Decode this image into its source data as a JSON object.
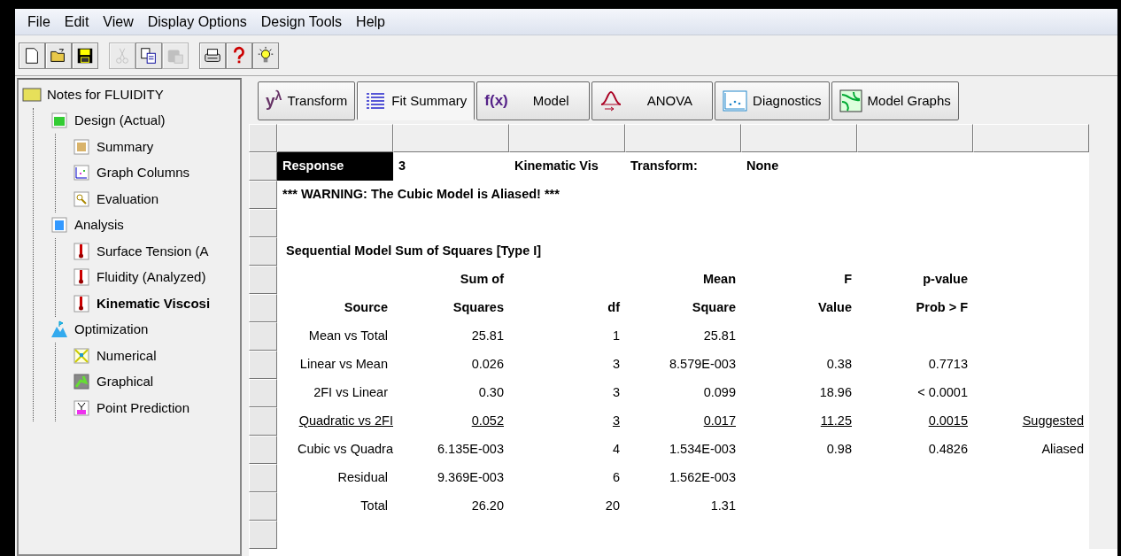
{
  "menu": [
    "File",
    "Edit",
    "View",
    "Display Options",
    "Design Tools",
    "Help"
  ],
  "toolbar": [
    {
      "kind": "new",
      "disabled": false
    },
    {
      "kind": "open",
      "disabled": false
    },
    {
      "kind": "save",
      "disabled": false
    },
    {
      "kind": "cut",
      "disabled": true
    },
    {
      "kind": "copy",
      "disabled": false
    },
    {
      "kind": "paste",
      "disabled": true
    },
    {
      "kind": "print",
      "disabled": false
    },
    {
      "kind": "help",
      "disabled": false
    },
    {
      "kind": "tip",
      "disabled": false
    }
  ],
  "tree": {
    "label": "Notes for FLUIDITY",
    "children": [
      {
        "label": "Design (Actual)",
        "kind": "design",
        "selected": false,
        "children": [
          {
            "label": "Summary",
            "kind": "summary",
            "selected": false
          },
          {
            "label": "Graph Columns",
            "kind": "graph",
            "selected": false
          },
          {
            "label": "Evaluation",
            "kind": "evaluation",
            "selected": false
          }
        ]
      },
      {
        "label": "Analysis",
        "kind": "analysis",
        "selected": false,
        "children": [
          {
            "label": "Surface Tension (A",
            "kind": "response",
            "selected": false
          },
          {
            "label": "Fluidity (Analyzed)",
            "kind": "response",
            "selected": false
          },
          {
            "label": "Kinematic Viscosi",
            "kind": "response",
            "selected": true
          }
        ]
      },
      {
        "label": "Optimization",
        "kind": "optimization",
        "selected": false,
        "children": [
          {
            "label": "Numerical",
            "kind": "numerical",
            "selected": false
          },
          {
            "label": "Graphical",
            "kind": "graphical",
            "selected": false
          },
          {
            "label": "Point Prediction",
            "kind": "point",
            "selected": false
          }
        ]
      }
    ]
  },
  "tabs": [
    {
      "kind": "transform",
      "icon_text": "y",
      "icon_sup": "λ",
      "label": "Transform",
      "selected": false
    },
    {
      "kind": "fit",
      "label": "Fit Summary",
      "selected": true
    },
    {
      "kind": "model",
      "icon_text": "f(x)",
      "label": "Model",
      "selected": false
    },
    {
      "kind": "anova",
      "label": "ANOVA",
      "selected": false
    },
    {
      "kind": "diagnostics",
      "label": "Diagnostics",
      "selected": false
    },
    {
      "kind": "graphs",
      "label": "Model Graphs",
      "selected": false
    }
  ],
  "response": {
    "label": "Response",
    "selected": true,
    "number": "3",
    "name": "Kinematic Vis",
    "transform_label": "Transform:",
    "transform": "None"
  },
  "warning": "*** WARNING:  The Cubic Model is Aliased! ***",
  "table_title": "Sequential Model Sum of Squares [Type I]",
  "header_rows": [
    [
      null,
      "Sum of",
      null,
      "Mean",
      "F",
      "p-value",
      null
    ],
    [
      "Source",
      "Squares",
      "df",
      "Square",
      "Value",
      "Prob > F",
      null
    ]
  ],
  "rows": [
    {
      "cells": [
        "Mean vs Total",
        "25.81",
        "1",
        "25.81",
        null,
        null,
        null
      ],
      "suggested": false
    },
    {
      "cells": [
        "Linear vs Mean",
        "0.026",
        "3",
        "8.579E-003",
        "0.38",
        "0.7713",
        null
      ],
      "suggested": false
    },
    {
      "cells": [
        "2FI vs Linear",
        "0.30",
        "3",
        "0.099",
        "18.96",
        "< 0.0001",
        null
      ],
      "suggested": false
    },
    {
      "cells": [
        "Quadratic vs 2FI",
        "0.052",
        "3",
        "0.017",
        "11.25",
        "0.0015",
        "Suggested"
      ],
      "suggested": true
    },
    {
      "cells": [
        "Cubic vs Quadra",
        "6.135E-003",
        "4",
        "1.534E-003",
        "0.98",
        "0.4826",
        "Aliased"
      ],
      "suggested": false
    },
    {
      "cells": [
        "Residual",
        "9.369E-003",
        "6",
        "1.562E-003",
        null,
        null,
        null
      ],
      "suggested": false
    },
    {
      "cells": [
        "Total",
        "26.20",
        "20",
        "1.31",
        null,
        null,
        null
      ],
      "suggested": false
    }
  ]
}
